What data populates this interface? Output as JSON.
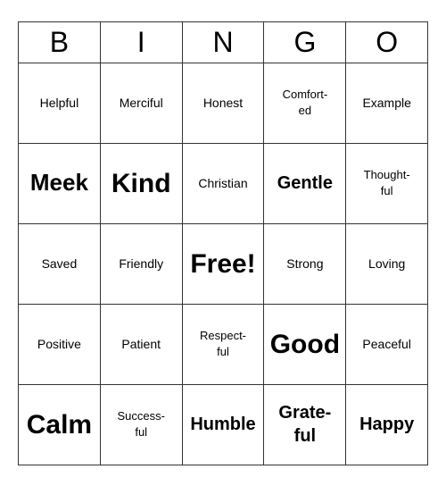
{
  "header": {
    "letters": [
      "B",
      "I",
      "N",
      "G",
      "O"
    ]
  },
  "grid": [
    [
      {
        "text": "Helpful",
        "size": "normal"
      },
      {
        "text": "Merciful",
        "size": "normal"
      },
      {
        "text": "Honest",
        "size": "normal"
      },
      {
        "text": "Comfort-\ned",
        "size": "small"
      },
      {
        "text": "Example",
        "size": "normal"
      }
    ],
    [
      {
        "text": "Meek",
        "size": "large"
      },
      {
        "text": "Kind",
        "size": "xlarge"
      },
      {
        "text": "Christian",
        "size": "normal"
      },
      {
        "text": "Gentle",
        "size": "medium"
      },
      {
        "text": "Thought-\nful",
        "size": "small"
      }
    ],
    [
      {
        "text": "Saved",
        "size": "normal"
      },
      {
        "text": "Friendly",
        "size": "normal"
      },
      {
        "text": "Free!",
        "size": "xlarge"
      },
      {
        "text": "Strong",
        "size": "normal"
      },
      {
        "text": "Loving",
        "size": "normal"
      }
    ],
    [
      {
        "text": "Positive",
        "size": "normal"
      },
      {
        "text": "Patient",
        "size": "normal"
      },
      {
        "text": "Respect-\nful",
        "size": "small"
      },
      {
        "text": "Good",
        "size": "xlarge"
      },
      {
        "text": "Peaceful",
        "size": "normal"
      }
    ],
    [
      {
        "text": "Calm",
        "size": "xlarge"
      },
      {
        "text": "Success-\nful",
        "size": "small"
      },
      {
        "text": "Humble",
        "size": "medium"
      },
      {
        "text": "Grate-\nful",
        "size": "medium"
      },
      {
        "text": "Happy",
        "size": "medium"
      }
    ]
  ]
}
